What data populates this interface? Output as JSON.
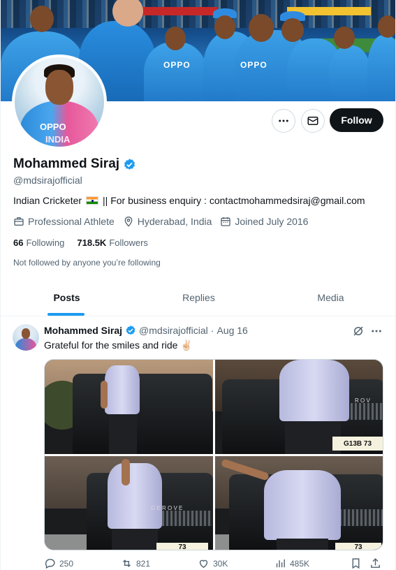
{
  "profile": {
    "name": "Mohammed Siraj",
    "handle": "@mdsirajofficial",
    "bio_prefix": "Indian Cricketer",
    "bio_suffix": "|| For business enquiry : contactmohammedsiraj@gmail.com",
    "category": "Professional Athlete",
    "location": "Hyderabad, India",
    "joined": "Joined July 2016",
    "following_count": "66",
    "following_label": "Following",
    "followers_count": "718.5K",
    "followers_label": "Followers",
    "not_followed_text": "Not followed by anyone you’re following",
    "follow_button": "Follow",
    "avatar_text_1": "OPPO",
    "avatar_text_2": "INDIA"
  },
  "banner": {
    "sponsor_text_1": "OPPO",
    "sponsor_text_2": "OPPO"
  },
  "tabs": [
    {
      "label": "Posts",
      "active": true
    },
    {
      "label": "Replies",
      "active": false
    },
    {
      "label": "Media",
      "active": false
    }
  ],
  "post": {
    "author_name": "Mohammed Siraj",
    "author_handle": "@mdsirajofficial",
    "separator": "·",
    "date": "Aug 16",
    "text": "Grateful for the smiles and ride ✌🏻",
    "plate_text_1": "G13B 73",
    "plate_text_2": "73",
    "plate_text_3": "73",
    "car_text": "R O V",
    "car_text_2": "G E   R O V E",
    "replies": "250",
    "reposts": "821",
    "likes": "30K",
    "views": "485K"
  },
  "colors": {
    "accent": "#1d9bf0",
    "text_primary": "#0f1419",
    "text_secondary": "#536471",
    "follow_bg": "#0f1419",
    "verified": "#1d9bf0"
  },
  "icons": [
    "more-icon",
    "message-icon",
    "verified-badge-icon",
    "briefcase-icon",
    "location-icon",
    "calendar-icon",
    "grok-icon",
    "reply-icon",
    "repost-icon",
    "like-icon",
    "views-icon",
    "bookmark-icon",
    "share-icon"
  ]
}
